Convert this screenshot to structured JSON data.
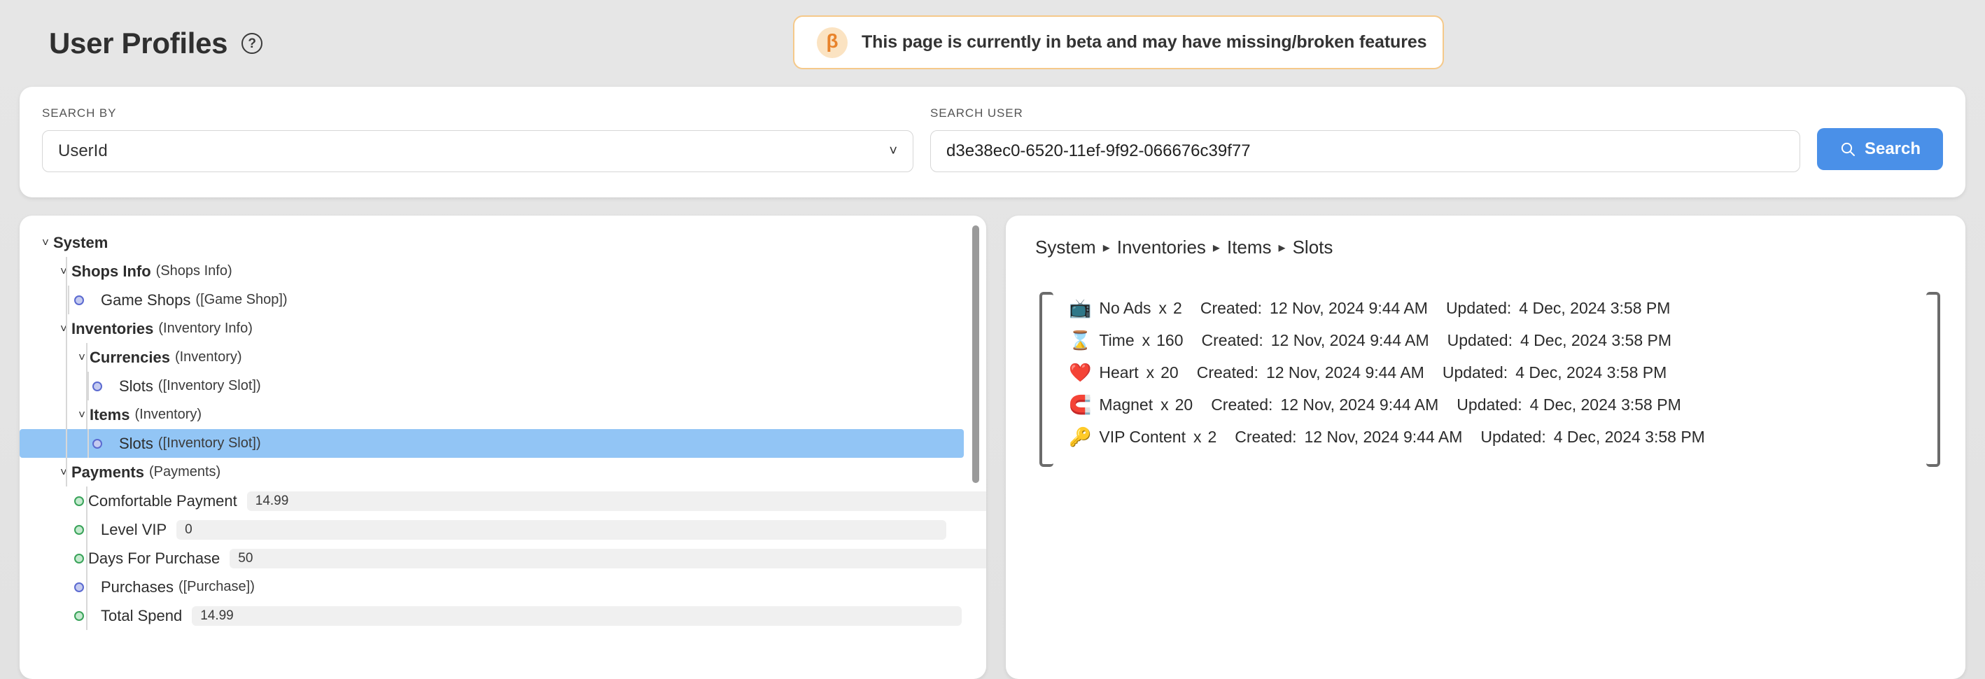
{
  "header": {
    "title": "User Profiles",
    "help_icon": "question-circle-icon",
    "beta": {
      "badge": "β",
      "text": "This page is currently in beta and may have missing/broken features"
    }
  },
  "search": {
    "search_by_label": "SEARCH BY",
    "search_by_value": "UserId",
    "chevron": "˅",
    "search_user_label": "SEARCH USER",
    "search_user_value": "d3e38ec0-6520-11ef-9f92-066676c39f77",
    "search_user_placeholder": "",
    "button_label": "Search"
  },
  "tree": [
    {
      "depth": 0,
      "kind": "branch",
      "chevron": "˅",
      "name": "System",
      "type": ""
    },
    {
      "depth": 1,
      "kind": "branch",
      "chevron": "˅",
      "name": "Shops Info",
      "type": "(Shops Info)"
    },
    {
      "depth": 2,
      "kind": "leaf",
      "bullet": "blue",
      "name": "Game Shops",
      "type": "([Game Shop])"
    },
    {
      "depth": 1,
      "kind": "branch",
      "chevron": "˅",
      "name": "Inventories",
      "type": "(Inventory Info)"
    },
    {
      "depth": 2,
      "kind": "branch",
      "chevron": "˅",
      "name": "Currencies",
      "type": "(Inventory)"
    },
    {
      "depth": 3,
      "kind": "leaf",
      "bullet": "blue",
      "name": "Slots",
      "type": "([Inventory Slot])"
    },
    {
      "depth": 2,
      "kind": "branch",
      "chevron": "˅",
      "name": "Items",
      "type": "(Inventory)"
    },
    {
      "depth": 3,
      "kind": "leaf",
      "bullet": "blue",
      "name": "Slots",
      "type": "([Inventory Slot])",
      "selected": true
    },
    {
      "depth": 1,
      "kind": "branch",
      "chevron": "˅",
      "name": "Payments",
      "type": "(Payments)"
    },
    {
      "depth": 2,
      "kind": "value",
      "bullet": "green",
      "name": "Comfortable Payment",
      "value": "14.99"
    },
    {
      "depth": 2,
      "kind": "value",
      "bullet": "green",
      "name": "Level VIP",
      "value": "0"
    },
    {
      "depth": 2,
      "kind": "value",
      "bullet": "green",
      "name": "Days For Purchase",
      "value": "50"
    },
    {
      "depth": 2,
      "kind": "leaf",
      "bullet": "blue",
      "name": "Purchases",
      "type": "([Purchase])"
    },
    {
      "depth": 2,
      "kind": "value",
      "bullet": "green",
      "name": "Total Spend",
      "value": "14.99"
    }
  ],
  "detail": {
    "breadcrumb": [
      "System",
      "Inventories",
      "Items",
      "Slots"
    ],
    "breadcrumb_separator": "▸",
    "created_label": "Created:",
    "updated_label": "Updated:",
    "multiplier": "x",
    "items": [
      {
        "icon": "📺",
        "icon_name": "no-ads-icon",
        "name": "No Ads",
        "qty": "2",
        "created": "12 Nov, 2024 9:44 AM",
        "updated": "4 Dec, 2024 3:58 PM"
      },
      {
        "icon": "⌛",
        "icon_name": "hourglass-icon",
        "name": "Time",
        "qty": "160",
        "created": "12 Nov, 2024 9:44 AM",
        "updated": "4 Dec, 2024 3:58 PM"
      },
      {
        "icon": "❤️",
        "icon_name": "heart-icon",
        "name": "Heart",
        "qty": "20",
        "created": "12 Nov, 2024 9:44 AM",
        "updated": "4 Dec, 2024 3:58 PM"
      },
      {
        "icon": "🧲",
        "icon_name": "magnet-icon",
        "name": "Magnet",
        "qty": "20",
        "created": "12 Nov, 2024 9:44 AM",
        "updated": "4 Dec, 2024 3:58 PM"
      },
      {
        "icon": "🔑",
        "icon_name": "key-icon",
        "name": "VIP Content",
        "qty": "2",
        "created": "12 Nov, 2024 9:44 AM",
        "updated": "4 Dec, 2024 3:58 PM"
      }
    ]
  },
  "colors": {
    "accent": "#4a90e8",
    "beta": "#e8822a",
    "selection": "#92c5f5",
    "bullet_blue": "#5b6ad0",
    "bullet_green": "#3aa35a"
  }
}
